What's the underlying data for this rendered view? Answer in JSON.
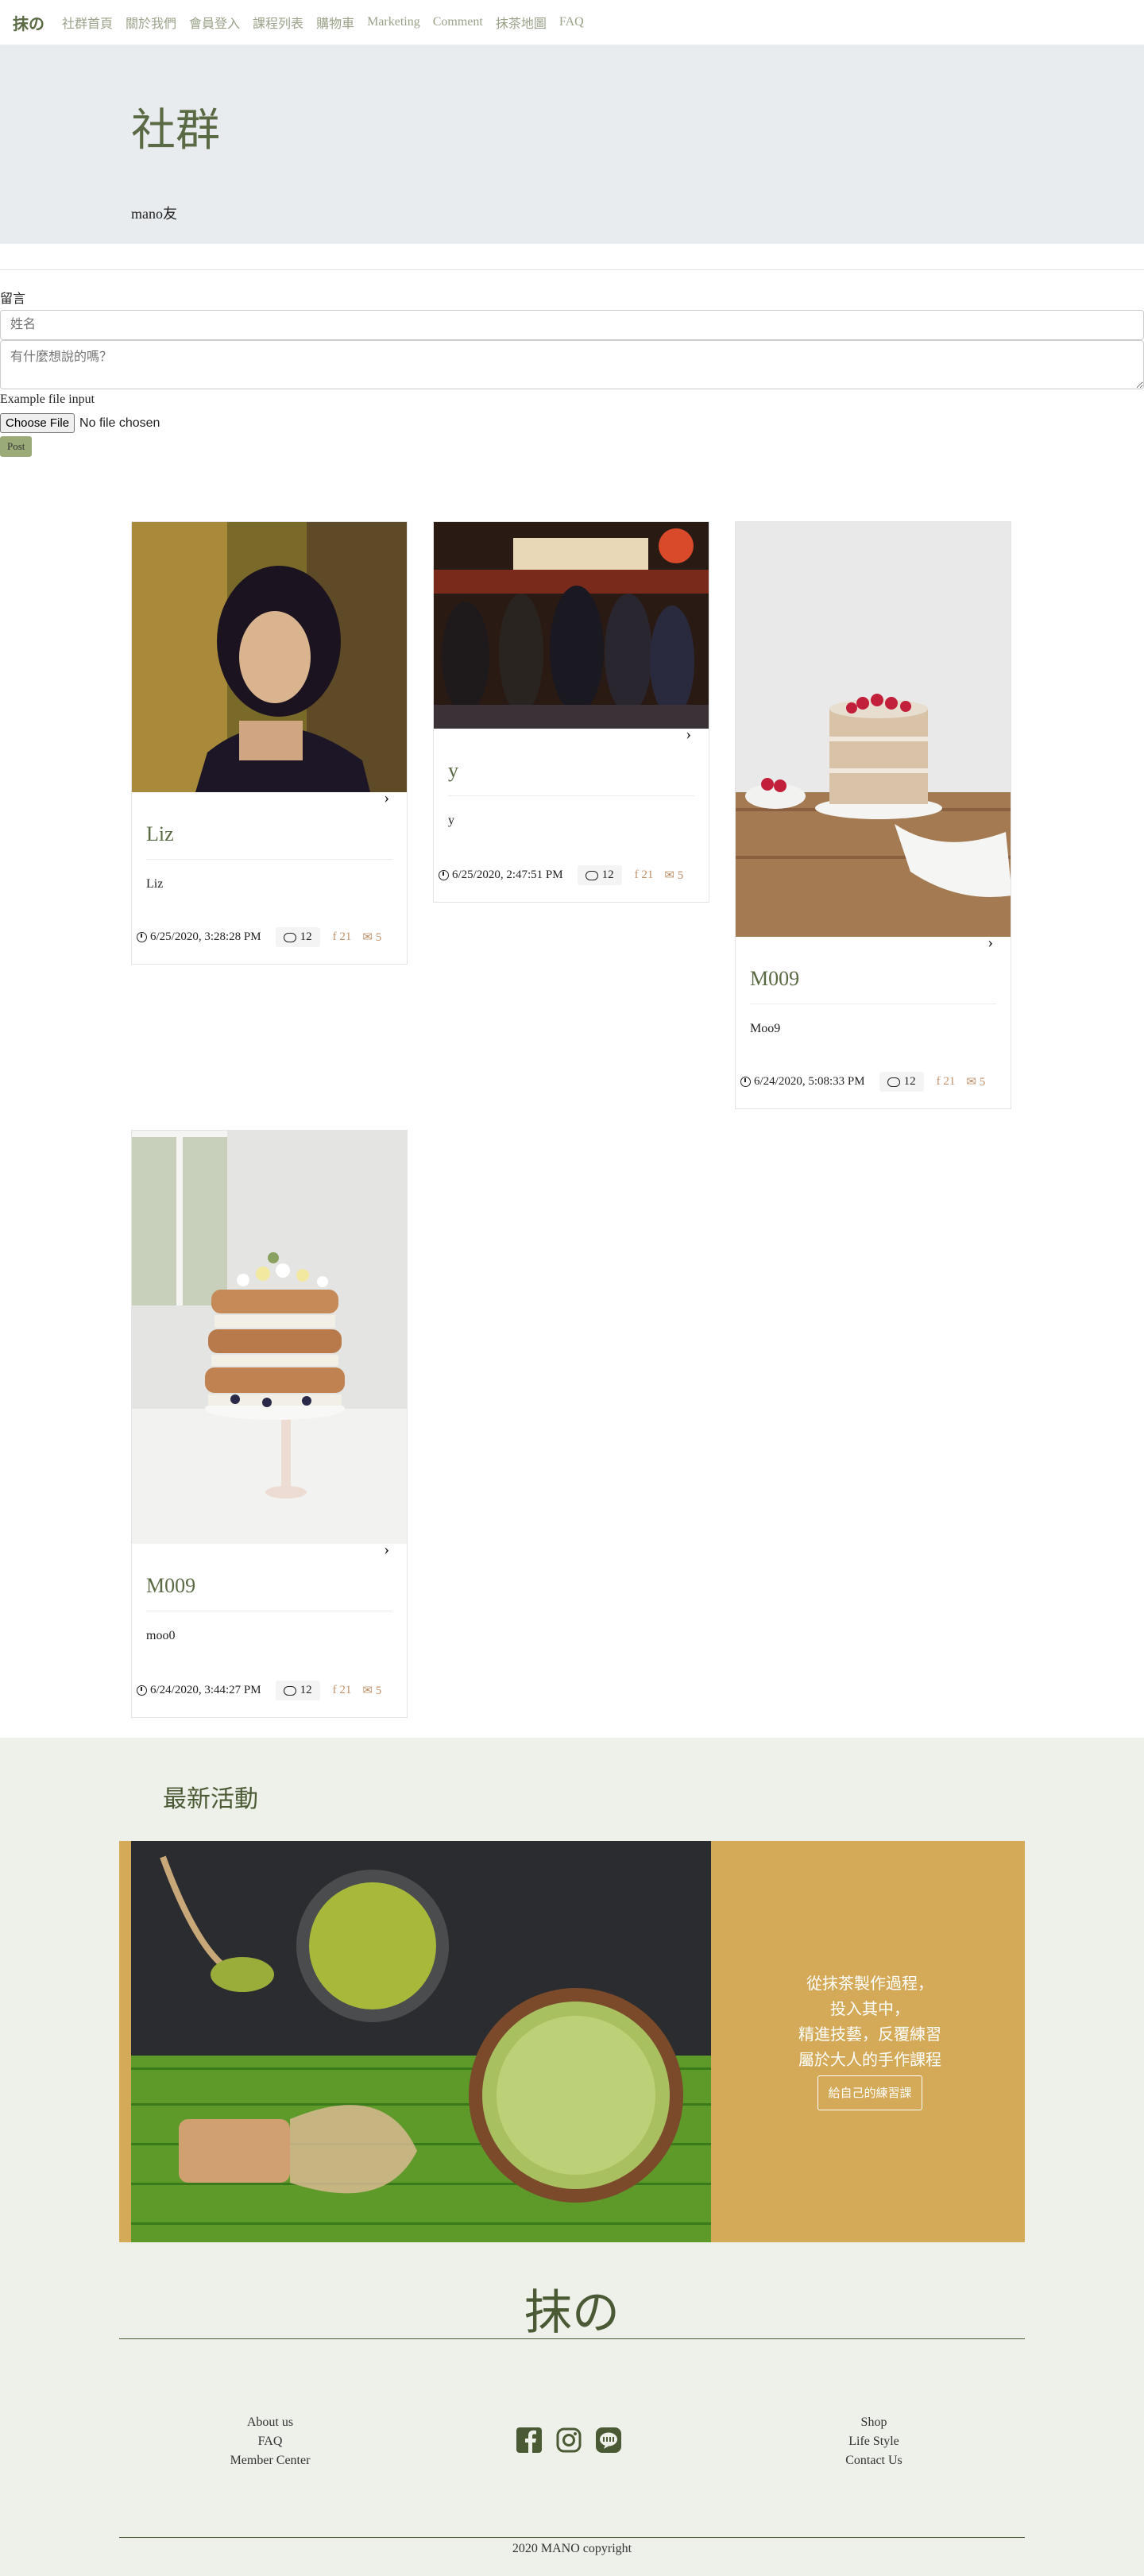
{
  "nav": {
    "brand": "抹の",
    "links": [
      "社群首頁",
      "關於我們",
      "會員登入",
      "課程列表",
      "購物車",
      "Marketing",
      "Comment",
      "抹茶地圖",
      "FAQ"
    ]
  },
  "hero": {
    "title": "社群",
    "subtitle": "mano友"
  },
  "form": {
    "section_label": "留言",
    "name_placeholder": "姓名",
    "message_placeholder": "有什麼想說的嗎？",
    "file_label": "Example file input",
    "file_button": "Choose File",
    "file_status": "No file chosen",
    "post_button": "Post"
  },
  "posts": [
    {
      "title": "Liz",
      "text": "Liz",
      "date": "6/25/2020, 3:28:28 PM",
      "comments": "12",
      "facebook": "21",
      "twitter": "5"
    },
    {
      "title": "y",
      "text": "y",
      "date": "6/25/2020, 2:47:51 PM",
      "comments": "12",
      "facebook": "21",
      "twitter": "5"
    },
    {
      "title": "M009",
      "text": "Moo9",
      "date": "6/24/2020, 5:08:33 PM",
      "comments": "12",
      "facebook": "21",
      "twitter": "5"
    },
    {
      "title": "M009",
      "text": "moo0",
      "date": "6/24/2020, 3:44:27 PM",
      "comments": "12",
      "facebook": "21",
      "twitter": "5"
    }
  ],
  "activity": {
    "title": "最新活動",
    "lines": [
      "從抹茶製作過程，",
      "投入其中，",
      "精進技藝，反覆練習",
      "屬於大人的手作課程"
    ],
    "button": "給自己的練習課"
  },
  "footer": {
    "logo": "抹の",
    "left_links": [
      "About us",
      "FAQ",
      "Member Center"
    ],
    "right_links": [
      "Shop",
      "Life Style",
      "Contact Us"
    ],
    "copyright": "2020 MANO copyright"
  },
  "icon_names": [
    "facebook-icon",
    "instagram-icon",
    "line-icon",
    "clock-icon",
    "comment-icon",
    "chevron-right-icon"
  ],
  "colors": {
    "accent": "#5a6a44",
    "banner": "#d4aa58",
    "footer_bg": "#eef0ea",
    "social": "#c0906a"
  }
}
